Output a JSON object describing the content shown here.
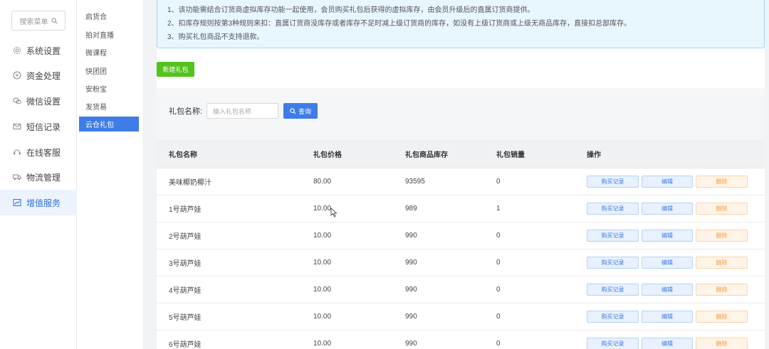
{
  "sidebar": {
    "search_placeholder": "搜索菜单",
    "items": [
      {
        "label": "系统设置",
        "icon": "gear-icon"
      },
      {
        "label": "资金处理",
        "icon": "yen-icon"
      },
      {
        "label": "微信设置",
        "icon": "wechat-icon"
      },
      {
        "label": "短信记录",
        "icon": "mail-icon"
      },
      {
        "label": "在线客服",
        "icon": "headset-icon"
      },
      {
        "label": "物流管理",
        "icon": "truck-icon"
      },
      {
        "label": "增值服务",
        "icon": "chart-icon",
        "active": true
      }
    ]
  },
  "subnav": {
    "items": [
      {
        "label": "启货合"
      },
      {
        "label": "拍对直播"
      },
      {
        "label": "微课程"
      },
      {
        "label": "快团团"
      },
      {
        "label": "安粉宝"
      },
      {
        "label": "发货易"
      },
      {
        "label": "云仓礼包",
        "active": true
      }
    ]
  },
  "notice": {
    "lines": [
      "1、该功能需结合订货商虚拟库存功能一起使用，会员购买礼包后获得的虚拟库存，由会员升级后的直属订货商提供。",
      "2、扣库存规则按第3种规则来扣：直属订货商没库存或者库存不足时减上级订货商的库存，如没有上级订货商或上级无商品库存，直接扣总部库存。",
      "3、购买礼包商品不支持退款。"
    ]
  },
  "actions": {
    "new_label": "新建礼包"
  },
  "filter": {
    "label": "礼包名称:",
    "placeholder": "输入礼包名称",
    "query_label": "查询"
  },
  "table": {
    "headers": [
      "礼包名称",
      "礼包价格",
      "礼包商品库存",
      "礼包销量",
      "操作"
    ],
    "op_labels": {
      "buy": "购买记录",
      "edit": "编辑",
      "delete": "删除"
    },
    "rows": [
      {
        "name": "美味椰奶椰汁",
        "price": "80.00",
        "stock": "93595",
        "sales": "0"
      },
      {
        "name": "1号葫芦娃",
        "price": "10.00",
        "stock": "989",
        "sales": "1"
      },
      {
        "name": "2号葫芦娃",
        "price": "10.00",
        "stock": "990",
        "sales": "0"
      },
      {
        "name": "3号葫芦娃",
        "price": "10.00",
        "stock": "990",
        "sales": "0"
      },
      {
        "name": "4号葫芦娃",
        "price": "10.00",
        "stock": "990",
        "sales": "0"
      },
      {
        "name": "5号葫芦娃",
        "price": "10.00",
        "stock": "990",
        "sales": "0"
      },
      {
        "name": "6号葫芦娃",
        "price": "10.00",
        "stock": "990",
        "sales": "0"
      }
    ]
  },
  "colors": {
    "primary": "#3e7de8",
    "success": "#52c41a",
    "danger_text": "#f59a45"
  }
}
